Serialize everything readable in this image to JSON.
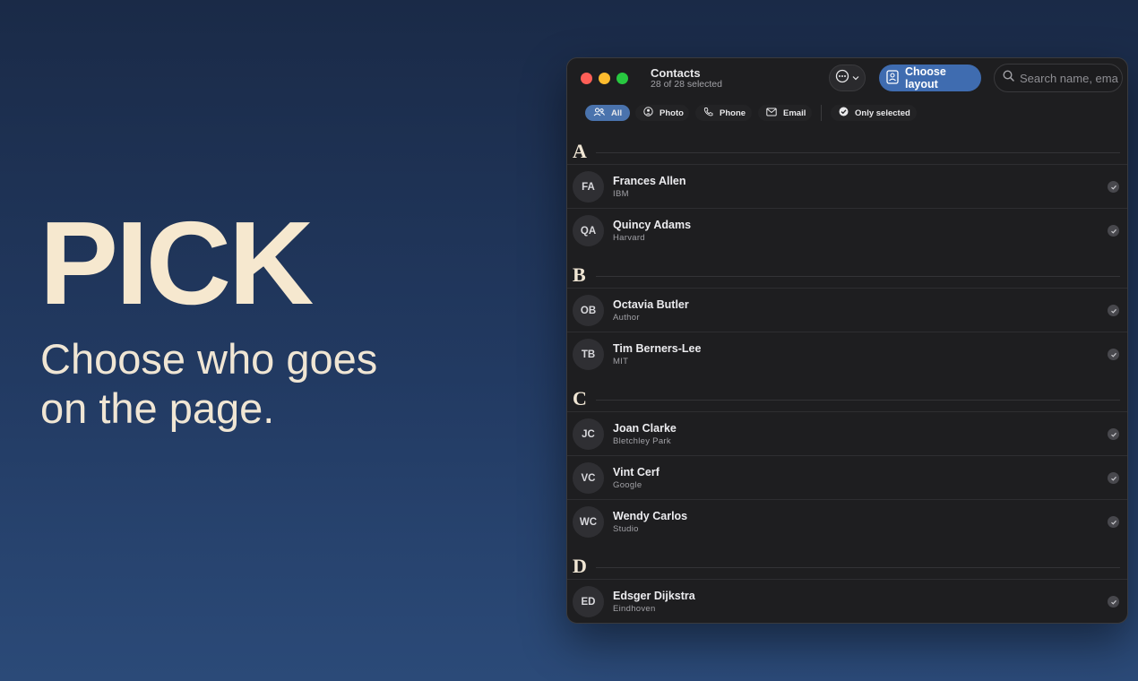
{
  "hero": {
    "title": "PICK",
    "subtitle": "Choose who goes on the page."
  },
  "window": {
    "title": "Contacts",
    "subtitle": "28 of 28 selected",
    "menu_icon": "ellipsis-circle-icon",
    "layout_button": {
      "label": "Choose layout",
      "icon": "document-icon"
    },
    "search": {
      "placeholder": "Search name, email",
      "value": ""
    }
  },
  "filters": [
    {
      "label": "All",
      "icon": "people-icon",
      "active": true
    },
    {
      "label": "Photo",
      "icon": "person-circle-icon",
      "active": false
    },
    {
      "label": "Phone",
      "icon": "phone-icon",
      "active": false
    },
    {
      "label": "Email",
      "icon": "envelope-icon",
      "active": false
    },
    {
      "label": "Only selected",
      "icon": "checkmark-circle-icon",
      "active": false
    }
  ],
  "sections": [
    {
      "letter": "A",
      "contacts": [
        {
          "initials": "FA",
          "name": "Frances Allen",
          "org": "IBM",
          "selected": true
        },
        {
          "initials": "QA",
          "name": "Quincy Adams",
          "org": "Harvard",
          "selected": true
        }
      ]
    },
    {
      "letter": "B",
      "contacts": [
        {
          "initials": "OB",
          "name": "Octavia Butler",
          "org": "Author",
          "selected": true
        },
        {
          "initials": "TB",
          "name": "Tim Berners-Lee",
          "org": "MIT",
          "selected": true
        }
      ]
    },
    {
      "letter": "C",
      "contacts": [
        {
          "initials": "JC",
          "name": "Joan Clarke",
          "org": "Bletchley Park",
          "selected": true
        },
        {
          "initials": "VC",
          "name": "Vint Cerf",
          "org": "Google",
          "selected": true
        },
        {
          "initials": "WC",
          "name": "Wendy Carlos",
          "org": "Studio",
          "selected": true
        }
      ]
    },
    {
      "letter": "D",
      "contacts": [
        {
          "initials": "ED",
          "name": "Edsger Dijkstra",
          "org": "Eindhoven",
          "selected": true
        }
      ]
    }
  ],
  "colors": {
    "accent": "#3f6cb0",
    "hero_title": "#f6e8cf",
    "background_top": "#1a2a47",
    "background_bottom": "#2b4a78"
  }
}
